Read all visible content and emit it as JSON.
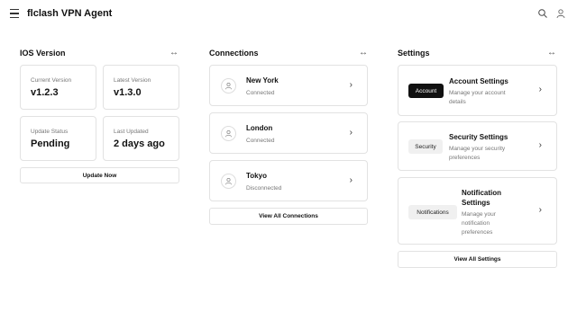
{
  "header": {
    "title": "flclash VPN Agent",
    "menu_icon": "hamburger-menu-icon",
    "search_icon": "search-icon",
    "user_icon": "user-icon"
  },
  "ios": {
    "title": "IOS Version",
    "expand_icon": "↔",
    "current_label": "Current Version",
    "current_value": "v1.2.3",
    "latest_label": "Latest Version",
    "latest_value": "v1.3.0",
    "status_label": "Update Status",
    "status_value": "Pending",
    "updated_label": "Last Updated",
    "updated_value": "2 days ago",
    "update_button": "Update Now"
  },
  "connections": {
    "title": "Connections",
    "expand_icon": "↔",
    "items": [
      {
        "name": "New York",
        "status": "Connected"
      },
      {
        "name": "London",
        "status": "Connected"
      },
      {
        "name": "Tokyo",
        "status": "Disconnected"
      }
    ],
    "view_all": "View All Connections"
  },
  "settings": {
    "title": "Settings",
    "expand_icon": "↔",
    "items": [
      {
        "badge": "Account",
        "title": "Account Settings",
        "desc": "Manage your account details"
      },
      {
        "badge": "Security",
        "title": "Security Settings",
        "desc": "Manage your security preferences"
      },
      {
        "badge": "Notifications",
        "title": "Notification Settings",
        "desc": "Manage your notification preferences"
      }
    ],
    "view_all": "View All Settings"
  },
  "chevron": "›"
}
